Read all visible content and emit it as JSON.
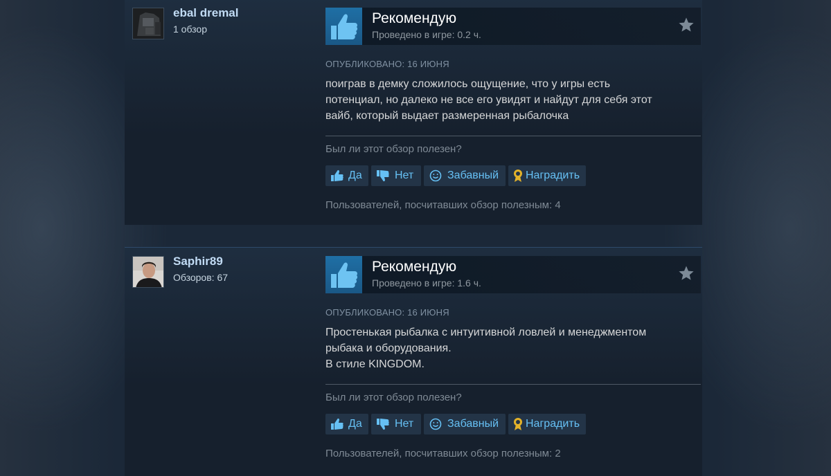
{
  "reviews": [
    {
      "author_name": "ebal dremal",
      "author_reviews": "1 обзор",
      "verdict": "Рекомендую",
      "playtime": "Проведено в игре: 0.2 ч.",
      "posted": "Опубликовано: 16 июня",
      "text_lines": [
        "поиграв в демку сложилось ощущение, что у игры есть",
        "потенциал, но далеко не все его увидят и найдут для себя этот",
        "вайб, который выдает размеренная рыбалочка"
      ],
      "helpful_question": "Был ли этот обзор полезен?",
      "buttons": {
        "yes": "Да",
        "no": "Нет",
        "funny": "Забавный",
        "award": "Наградить"
      },
      "helpful_count": "Пользователей, посчитавших обзор полезным: 4"
    },
    {
      "author_name": "Saphir89",
      "author_reviews": "Обзоров: 67",
      "verdict": "Рекомендую",
      "playtime": "Проведено в игре: 1.6 ч.",
      "posted": "Опубликовано: 16 июня",
      "text_lines": [
        "Простенькая рыбалка с интуитивной ловлей и менеджментом",
        "рыбака и оборудования.",
        "В стиле KINGDOM."
      ],
      "helpful_question": "Был ли этот обзор полезен?",
      "buttons": {
        "yes": "Да",
        "no": "Нет",
        "funny": "Забавный",
        "award": "Наградить"
      },
      "helpful_count": "Пользователей, посчитавших обзор полезным: 2"
    }
  ],
  "icons": {
    "verdict": "thumbs-up-icon",
    "star": "star-icon",
    "yes": "thumbs-up-icon",
    "no": "thumbs-down-icon",
    "funny": "smiley-icon",
    "award": "award-ribbon-icon"
  },
  "colors": {
    "page_bg": "#1b2838",
    "card_bg": "#16202d",
    "thumb_bg": "#1f6fa5",
    "link_blue": "#66c0f4",
    "button_bg": "#233447",
    "award_gold": "#e3b22a"
  }
}
